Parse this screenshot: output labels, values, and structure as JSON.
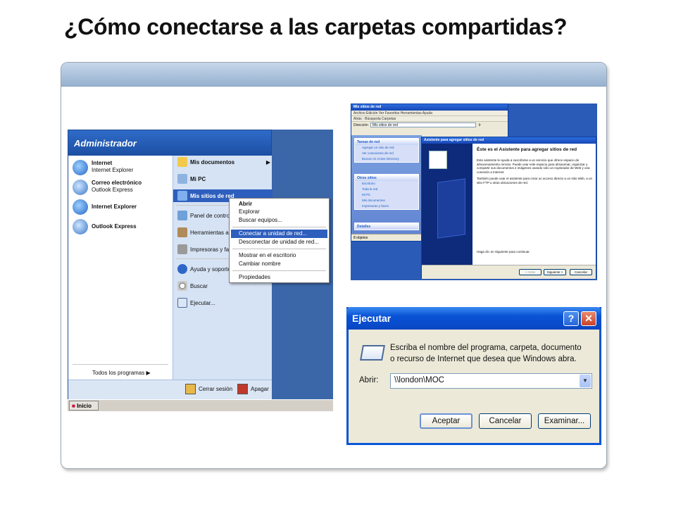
{
  "title": "¿Cómo conectarse a las carpetas compartidas?",
  "start_menu": {
    "header": "Administrador",
    "pinned": [
      {
        "title": "Internet",
        "sub": "Internet Explorer",
        "icon": "internet-explorer-icon"
      },
      {
        "title": "Correo electrónico",
        "sub": "Outlook Express",
        "icon": "outlook-express-icon"
      },
      {
        "title": "Internet Explorer",
        "sub": "",
        "icon": "internet-explorer-icon"
      },
      {
        "title": "Outlook Express",
        "sub": "",
        "icon": "outlook-express-icon"
      }
    ],
    "all_programs": "Todos los programas",
    "right_items": [
      {
        "label": "Mis documentos",
        "bold": true,
        "icon": "documents-folder-icon"
      },
      {
        "label": "Mi PC",
        "bold": true,
        "icon": "my-computer-icon"
      },
      {
        "label": "Mis sitios de red",
        "bold": true,
        "icon": "network-places-icon"
      },
      {
        "label": "Panel de contro",
        "icon": "control-panel-icon"
      },
      {
        "label": "Herramientas ac",
        "icon": "admin-tools-icon"
      },
      {
        "label": "Impresoras y fa",
        "icon": "printers-icon"
      },
      {
        "label": "Ayuda y soporte",
        "icon": "help-icon"
      },
      {
        "label": "Buscar",
        "icon": "search-icon"
      },
      {
        "label": "Ejecutar...",
        "icon": "run-icon"
      }
    ],
    "logoff": "Cerrar sesión",
    "shutdown": "Apagar",
    "start_button": "Inicio",
    "context_menu": [
      "Abrir",
      "Explorar",
      "Buscar equipos...",
      "Conectar a unidad de red...",
      "Desconectar de unidad de red...",
      "Mostrar en el escritorio",
      "Cambiar nombre",
      "Propiedades"
    ]
  },
  "network_window": {
    "title": "Mis sitios de red",
    "menu": "Archivo  Edición  Ver  Favoritos  Herramientas  Ayuda",
    "toolbar": "Atrás  ·  Búsqueda  Carpetas",
    "address_label": "Dirección",
    "address_value": "Mis sitios de red",
    "go": "Ir",
    "tasks_header": "Tareas de red",
    "tasks": [
      "Agregar un sitio de red",
      "Ver conexiones de red",
      "Buscar en Active Directory"
    ],
    "other_header": "Otros sitios",
    "other": [
      "Escritorio",
      "Toda la red",
      "Mi PC",
      "Mis documentos",
      "Impresoras y faxes"
    ],
    "details_header": "Detalles",
    "status": "8 objetos"
  },
  "wizard": {
    "title": "Asistente para agregar sitios de red",
    "heading": "Éste es el Asistente para agregar sitios de red",
    "p1": "Este asistente le ayuda a suscribirse a un servicio que ofrece espacio de almacenamiento remoto. Puede usar este espacio para almacenar, organizar y compartir sus documentos e imágenes usando sólo un explorador de Web y una conexión a Internet.",
    "p2": "También puede usar el asistente para crear un acceso directo a un sitio Web, a un sitio FTP u otras ubicaciones de red.",
    "next_hint": "Haga clic en Siguiente para continuar.",
    "back": "< Atrás",
    "next": "Siguiente >",
    "cancel": "Cancelar"
  },
  "run_dialog": {
    "title": "Ejecutar",
    "description": "Escriba el nombre del programa, carpeta, documento o recurso de Internet que desea que Windows abra.",
    "open_label": "Abrir:",
    "open_value": "\\\\london\\MOC",
    "ok": "Aceptar",
    "cancel": "Cancelar",
    "browse": "Examinar..."
  }
}
